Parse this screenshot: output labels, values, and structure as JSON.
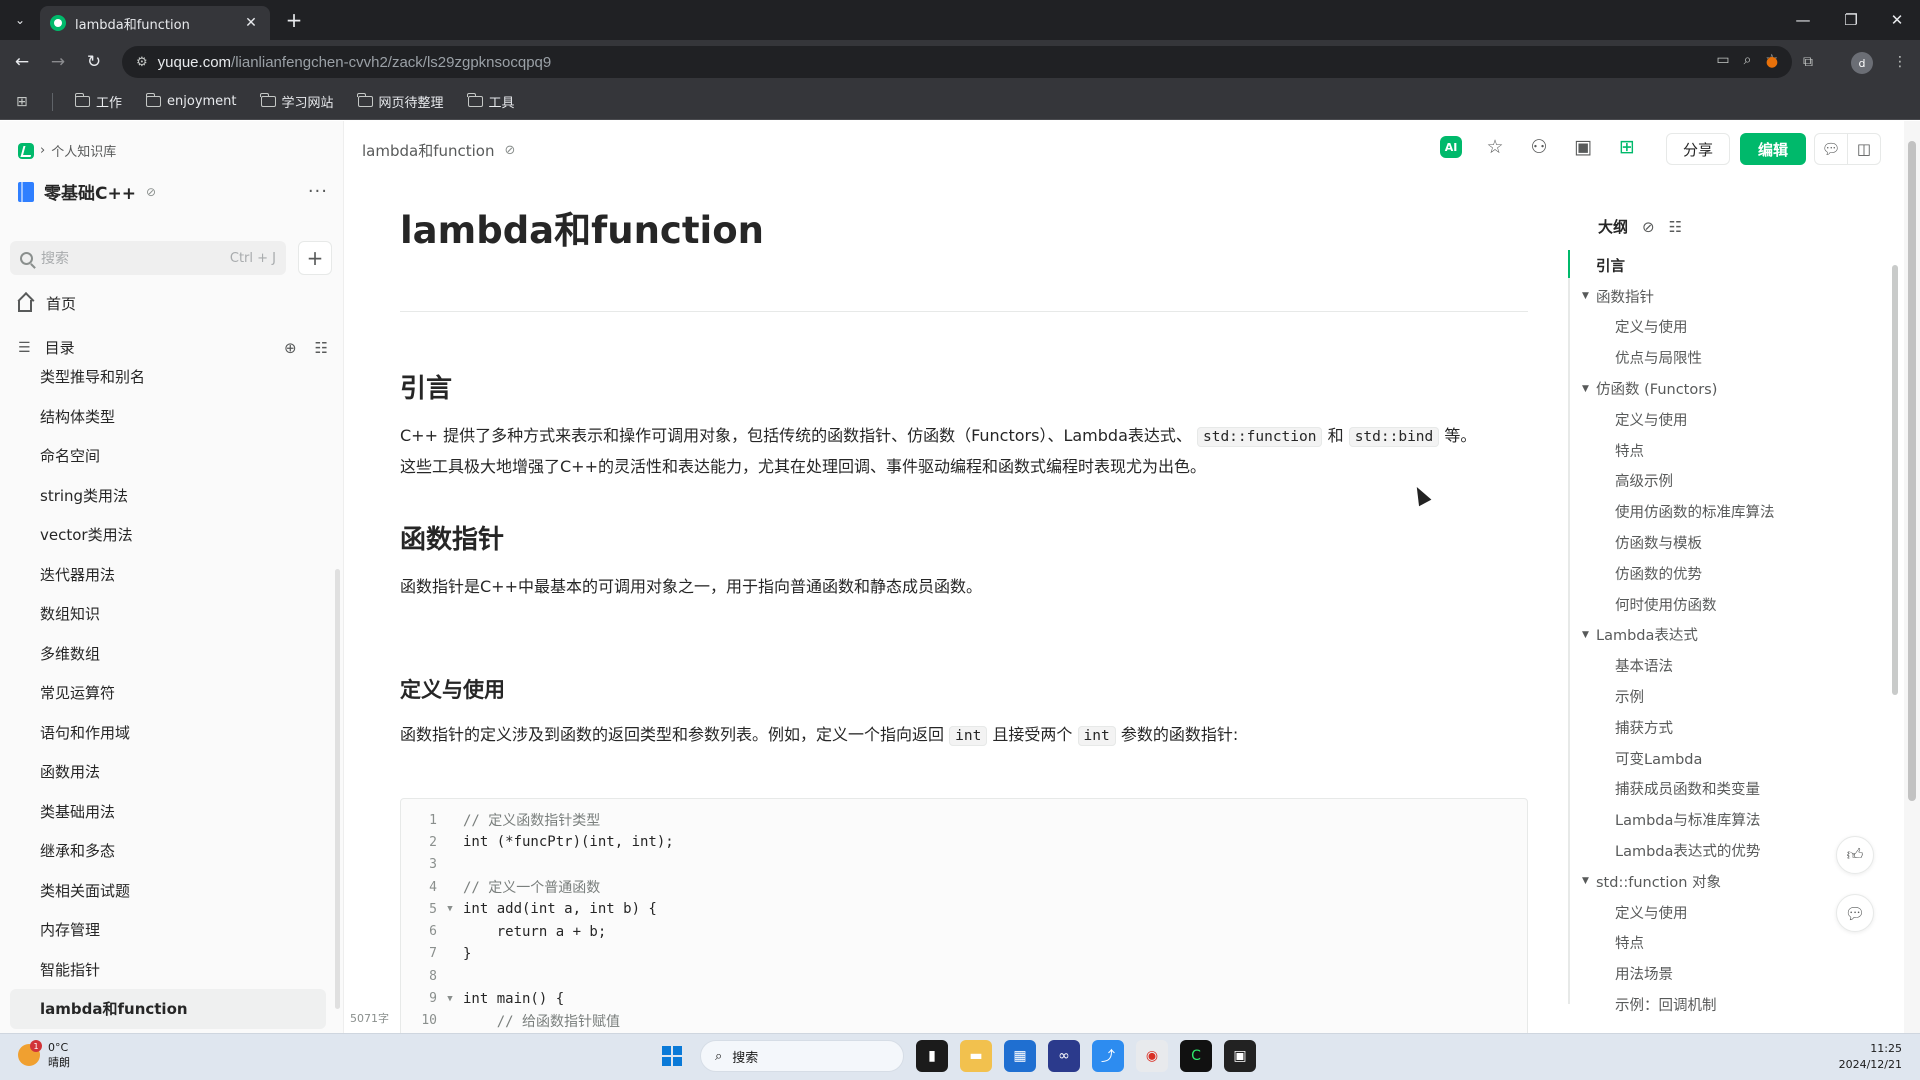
{
  "browser": {
    "tab_title": "lambda和function",
    "url_host": "yuque.com",
    "url_path": "/lianlianfengchen-cvvh2/zack/ls29zgpknsocqpq9",
    "bookmarks": [
      "工作",
      "enjoyment",
      "学习网站",
      "网页待整理",
      "工具"
    ],
    "profile_initial": "d"
  },
  "sidebar": {
    "breadcrumb": "个人知识库",
    "book_title": "零基础C++",
    "search_placeholder": "搜索",
    "search_shortcut": "Ctrl + J",
    "home_label": "首页",
    "toc_label": "目录",
    "items": [
      "类型推导和别名",
      "结构体类型",
      "命名空间",
      "string类用法",
      "vector类用法",
      "迭代器用法",
      "数组知识",
      "多维数组",
      "常见运算符",
      "语句和作用域",
      "函数用法",
      "类基础用法",
      "继承和多态",
      "类相关面试题",
      "内存管理",
      "智能指针",
      "lambda和function"
    ],
    "active_item": "lambda和function",
    "word_count": "5071字"
  },
  "header": {
    "doc_breadcrumb": "lambda和function",
    "ai_label": "AI",
    "share_label": "分享",
    "edit_label": "编辑"
  },
  "doc": {
    "title": "lambda和function",
    "h_intro": "引言",
    "intro_p1_a": "C++ 提供了多种方式来表示和操作可调用对象，包括传统的函数指针、仿函数（Functors）、Lambda表达式、",
    "intro_code1": "std::function",
    "intro_and": "和",
    "intro_code2": "std::bind",
    "intro_p1_b": "等。",
    "intro_p2": "这些工具极大地增强了C++的灵活性和表达能力，尤其在处理回调、事件驱动编程和函数式编程时表现尤为出色。",
    "h_funcptr": "函数指针",
    "funcptr_p": "函数指针是C++中最基本的可调用对象之一，用于指向普通函数和静态成员函数。",
    "h_def": "定义与使用",
    "def_p_a": "函数指针的定义涉及到函数的返回类型和参数列表。例如，定义一个指向返回",
    "def_code1": "int",
    "def_p_b": "且接受两个",
    "def_code2": "int",
    "def_p_c": "参数的函数指针:",
    "code_lines": [
      {
        "n": "1",
        "fold": "",
        "text": "// 定义函数指针类型",
        "comment": true
      },
      {
        "n": "2",
        "fold": "",
        "text": "int (*funcPtr)(int, int);",
        "comment": false
      },
      {
        "n": "3",
        "fold": "",
        "text": "",
        "comment": false
      },
      {
        "n": "4",
        "fold": "",
        "text": "// 定义一个普通函数",
        "comment": true
      },
      {
        "n": "5",
        "fold": "▼",
        "text": "int add(int a, int b) {",
        "comment": false
      },
      {
        "n": "6",
        "fold": "",
        "text": "    return a + b;",
        "comment": false
      },
      {
        "n": "7",
        "fold": "",
        "text": "}",
        "comment": false
      },
      {
        "n": "8",
        "fold": "",
        "text": "",
        "comment": false
      },
      {
        "n": "9",
        "fold": "▼",
        "text": "int main() {",
        "comment": false
      },
      {
        "n": "10",
        "fold": "",
        "text": "    // 给函数指针赋值",
        "comment": true
      }
    ]
  },
  "outline": {
    "title": "大纲",
    "items": [
      {
        "level": 1,
        "label": "引言",
        "toggle": false,
        "active": true
      },
      {
        "level": 1,
        "label": "函数指针",
        "toggle": true
      },
      {
        "level": 2,
        "label": "定义与使用"
      },
      {
        "level": 2,
        "label": "优点与局限性"
      },
      {
        "level": 1,
        "label": "仿函数 (Functors)",
        "toggle": true
      },
      {
        "level": 2,
        "label": "定义与使用"
      },
      {
        "level": 2,
        "label": "特点"
      },
      {
        "level": 2,
        "label": "高级示例"
      },
      {
        "level": 2,
        "label": "使用仿函数的标准库算法"
      },
      {
        "level": 2,
        "label": "仿函数与模板"
      },
      {
        "level": 2,
        "label": "仿函数的优势"
      },
      {
        "level": 2,
        "label": "何时使用仿函数"
      },
      {
        "level": 1,
        "label": "Lambda表达式",
        "toggle": true
      },
      {
        "level": 2,
        "label": "基本语法"
      },
      {
        "level": 2,
        "label": "示例"
      },
      {
        "level": 2,
        "label": "捕获方式"
      },
      {
        "level": 2,
        "label": "可变Lambda"
      },
      {
        "level": 2,
        "label": "捕获成员函数和类变量"
      },
      {
        "level": 2,
        "label": "Lambda与标准库算法"
      },
      {
        "level": 2,
        "label": "Lambda表达式的优势"
      },
      {
        "level": 1,
        "label": "std::function 对象",
        "toggle": true
      },
      {
        "level": 2,
        "label": "定义与使用"
      },
      {
        "level": 2,
        "label": "特点"
      },
      {
        "level": 2,
        "label": "用法场景"
      },
      {
        "level": 2,
        "label": "示例：回调机制"
      }
    ]
  },
  "taskbar": {
    "weather_temp": "0°C",
    "weather_desc": "晴朗",
    "weather_badge": "1",
    "search_label": "搜索",
    "time": "11:25",
    "date": "2024/12/21"
  },
  "colors": {
    "brand_green": "#00b96b",
    "browser_dark": "#202124",
    "browser_mid": "#35363a"
  }
}
